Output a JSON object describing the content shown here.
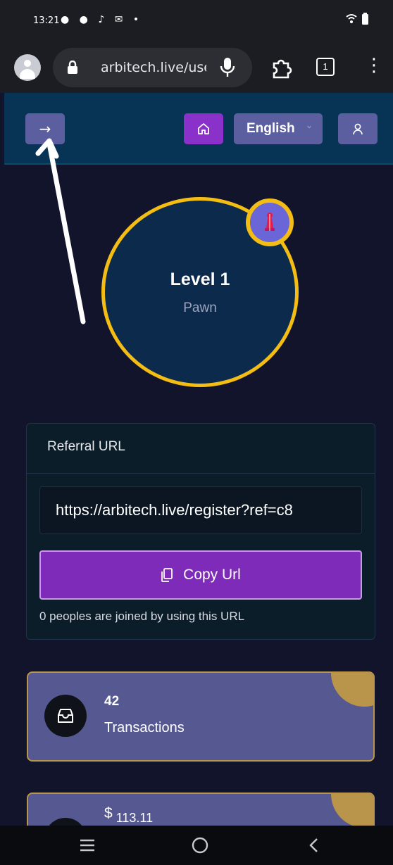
{
  "status": {
    "time": "13:21"
  },
  "browser": {
    "url": "arbitech.live/user",
    "tab_count": "1"
  },
  "topbar": {
    "language": "English"
  },
  "level": {
    "title": "Level 1",
    "rank": "Pawn"
  },
  "referral": {
    "title": "Referral URL",
    "url": "https://arbitech.live/register?ref=c8",
    "copy_label": "Copy Url",
    "note": "0 peoples are joined by using this URL"
  },
  "stats": [
    {
      "value": "42",
      "label": "Transactions"
    },
    {
      "currency": "$",
      "value": "113.11"
    }
  ],
  "colors": {
    "topbar": "#073455",
    "accent_purple": "#8a31c9",
    "button_indigo": "#5c5f9f",
    "ring_gold": "#f4bd14",
    "card_bg": "#565891"
  }
}
